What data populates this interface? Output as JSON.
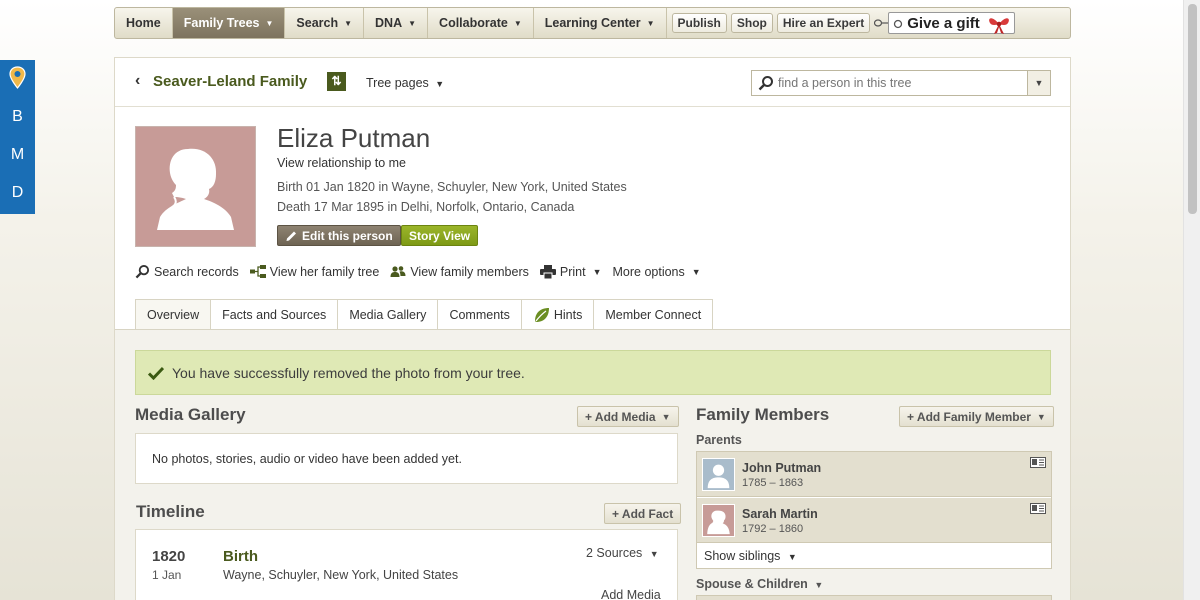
{
  "sidebar": {
    "letters": [
      "B",
      "M",
      "D"
    ],
    "pin_color": "#f0b84a"
  },
  "nav": {
    "items": [
      {
        "label": "Home",
        "caret": false
      },
      {
        "label": "Family Trees",
        "caret": true,
        "active": true
      },
      {
        "label": "Search",
        "caret": true
      },
      {
        "label": "DNA",
        "caret": true
      },
      {
        "label": "Collaborate",
        "caret": true
      },
      {
        "label": "Learning Center",
        "caret": true
      }
    ],
    "buttons": [
      "Publish",
      "Shop",
      "Hire an Expert"
    ],
    "gift": "Give a gift"
  },
  "tree": {
    "name": "Seaver-Leland Family",
    "pages_label": "Tree pages",
    "search_placeholder": "find a person in this tree"
  },
  "person": {
    "name": "Eliza Putman",
    "relationship_link": "View relationship to me",
    "birth": "Birth 01 Jan 1820 in Wayne, Schuyler, New York, United States",
    "death": "Death 17 Mar 1895 in Delhi, Norfolk, Ontario, Canada",
    "edit_label": "Edit this person",
    "story_label": "Story View"
  },
  "actions": {
    "search_records": "Search records",
    "family_tree": "View her family tree",
    "family_members": "View family members",
    "print": "Print",
    "more_options": "More options"
  },
  "tabs": [
    {
      "label": "Overview",
      "active": true
    },
    {
      "label": "Facts and Sources"
    },
    {
      "label": "Media Gallery"
    },
    {
      "label": "Comments"
    },
    {
      "label": "Hints"
    },
    {
      "label": "Member Connect"
    }
  ],
  "message": {
    "success": "You have successfully removed the photo from your tree."
  },
  "media": {
    "title": "Media Gallery",
    "add_label": "+ Add Media",
    "empty_text": "No photos, stories, audio or video have been added yet."
  },
  "timeline": {
    "title": "Timeline",
    "add_label": "+ Add Fact",
    "events": [
      {
        "year": "1820",
        "day": "1 Jan",
        "event": "Birth",
        "place": "Wayne, Schuyler, New York, United States",
        "sources": "2 Sources",
        "add_media": "Add Media"
      }
    ]
  },
  "family": {
    "title": "Family Members",
    "add_label": "+ Add Family Member",
    "parents_label": "Parents",
    "parents": [
      {
        "name": "John Putman",
        "years": "1785 – 1863",
        "gender": "male"
      },
      {
        "name": "Sarah Martin",
        "years": "1792 – 1860",
        "gender": "female"
      }
    ],
    "siblings_label": "Show siblings",
    "spouse_label": "Spouse & Children"
  },
  "colors": {
    "brand_green": "#4a5a1e",
    "story_green": "#8aa61f",
    "success_bg": "#dfe9b5",
    "female_silhouette_bg": "#c79b97",
    "male_silhouette_bg": "#a9bccb",
    "bmd_blue": "#1a6eb5"
  }
}
